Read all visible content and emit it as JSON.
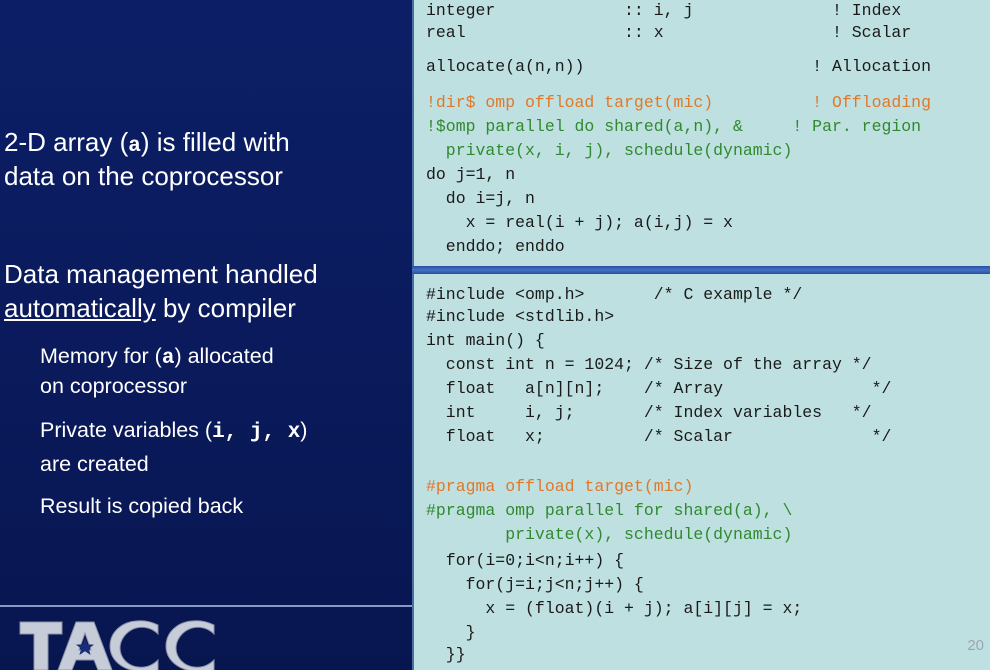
{
  "left": {
    "bullet1_line1": "2-D array (",
    "bullet1_code": "a",
    "bullet1_line1_end": ") is filled with",
    "bullet1_line2": "data on the coprocessor",
    "bullet2_line1": "Data management handled",
    "bullet2_line2_underlined": "automatically",
    "bullet2_line2_rest": " by compiler",
    "sub1_line1_pre": "Memory for (",
    "sub1_line1_code": "a",
    "sub1_line1_post": ") allocated",
    "sub1_line2": " on coprocessor",
    "sub2_line1_pre": "Private variables (",
    "sub2_line1_code": "i, j, x",
    "sub2_line1_post": ")",
    "sub2_line2": "are created",
    "sub3": "Result is copied back",
    "logo_text": "TACC"
  },
  "fortran": {
    "lines": [
      "integer             :: i, j              ! Index",
      "real                :: x                 ! Scalar",
      "allocate(a(n,n))                       ! Allocation",
      "!dir$ omp offload target(mic)          ! Offloading",
      "!$omp parallel do shared(a,n), &     ! Par. region",
      "  private(x, i, j), schedule(dynamic)",
      "do j=1, n",
      "  do i=j, n",
      "    x = real(i + j); a(i,j) = x",
      "  enddo; enddo"
    ]
  },
  "c_code": {
    "lines": [
      "#include <omp.h>       /* C example */",
      "#include <stdlib.h>",
      "int main() {",
      "  const int n = 1024; /* Size of the array */",
      "  float   a[n][n];    /* Array               */",
      "  int     i, j;       /* Index variables   */",
      "  float   x;          /* Scalar              */",
      "#pragma offload target(mic)",
      "#pragma omp parallel for shared(a), \\",
      "        private(x), schedule(dynamic)",
      "  for(i=0;i<n;i++) {",
      "    for(j=i;j<n;j++) {",
      "      x = (float)(i + j); a[i][j] = x;",
      "    }",
      "  }}"
    ]
  },
  "page_number": "20",
  "colors": {
    "panel_bg": "#bfe0e0",
    "left_bg": "#0a1a5c",
    "orange": "#e0782a",
    "green": "#2f8a2f"
  }
}
